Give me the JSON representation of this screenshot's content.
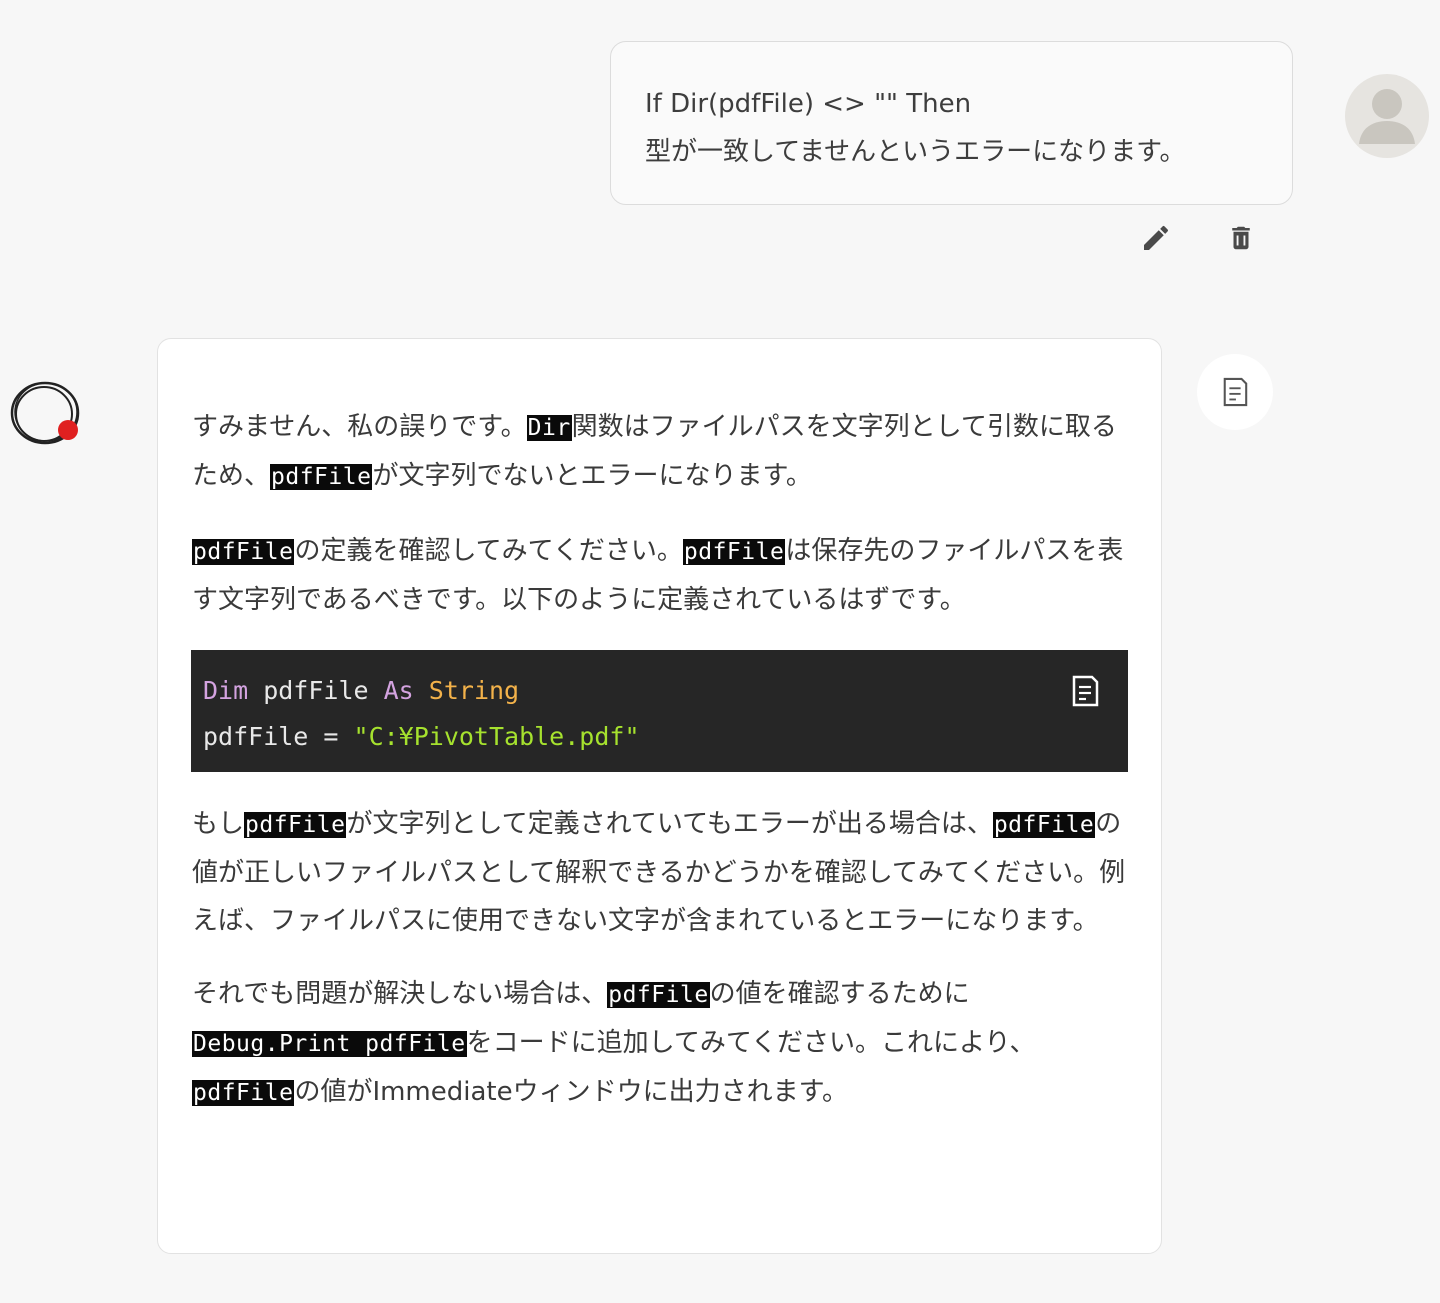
{
  "user_message": {
    "line1": "If Dir(pdfFile) <> \"\" Then",
    "line2": "型が一致してませんというエラーになります。"
  },
  "user_actions": {
    "edit_icon": "pencil-icon",
    "delete_icon": "trash-icon"
  },
  "assistant": {
    "copy_icon": "clipboard-icon",
    "p1": {
      "a": "すみません、私の誤りです。",
      "code1": "Dir",
      "b": "関数はファイルパスを文字列として引数に取るため、",
      "code2": "pdfFile",
      "c": "が文字列でないとエラーになります。"
    },
    "p2": {
      "code1": "pdfFile",
      "a": "の定義を確認してみてください。",
      "code2": "pdfFile",
      "b": "は保存先のファイルパスを表す文字列であるべきです。以下のように定義されているはずです。"
    },
    "code_block": {
      "line1_kw1": "Dim",
      "line1_var": " pdfFile ",
      "line1_kw2": "As",
      "line1_type": "String",
      "line2_var": "pdfFile = ",
      "line2_str": "\"C:¥PivotTable.pdf\"",
      "copy_icon": "clipboard-icon"
    },
    "p3": {
      "a": "もし",
      "code1": "pdfFile",
      "b": "が文字列として定義されていてもエラーが出る場合は、",
      "code2": "pdfFile",
      "c": "の値が正しいファイルパスとして解釈できるかどうかを確認してみてください。例えば、ファイルパスに使用できない文字が含まれているとエラーになります。"
    },
    "p4": {
      "a": "それでも問題が解決しない場合は、",
      "code1": "pdfFile",
      "b": "の値を確認するために",
      "code2": "Debug.Print pdfFile",
      "c": "をコードに追加してみてください。これにより、",
      "code3": "pdfFile",
      "d": "の値がImmediateウィンドウに出力されます。"
    }
  },
  "colors": {
    "background": "#f7f7f7",
    "code_bg": "#262626",
    "keyword": "#d4a3e0",
    "type": "#f3b24a",
    "string": "#a6e22e",
    "bot_dot": "#e02020"
  }
}
